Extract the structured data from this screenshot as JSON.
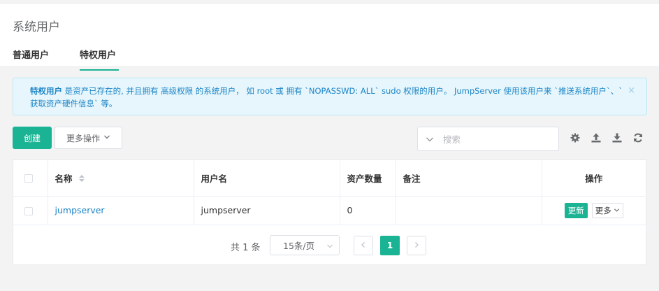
{
  "header": {
    "title": "系统用户",
    "tabs": [
      {
        "label": "普通用户",
        "active": false
      },
      {
        "label": "特权用户",
        "active": true
      }
    ]
  },
  "alert": {
    "strong": "特权用户",
    "text_line1": " 是资产已存在的, 并且拥有 高级权限 的系统用户， 如 root 或 拥有 `NOPASSWD: ALL` sudo 权限的用户。 JumpServer 使用该用户来 `推送系统用户`、`",
    "text_line2": "获取资产硬件信息` 等。",
    "close": "×"
  },
  "toolbar": {
    "create_label": "创建",
    "more_actions_label": "更多操作",
    "search_placeholder": "搜索",
    "icons": [
      "gear-icon",
      "upload-icon",
      "download-icon",
      "refresh-icon"
    ]
  },
  "table": {
    "columns": [
      "名称",
      "用户名",
      "资产数量",
      "备注",
      "操作"
    ],
    "rows": [
      {
        "name": "jumpserver",
        "username": "jumpserver",
        "asset_count": "0",
        "comment": "",
        "update_label": "更新",
        "more_label": "更多"
      }
    ]
  },
  "pagination": {
    "total_text": "共 1 条",
    "page_size_text": "15条/页",
    "current_page": "1"
  },
  "colors": {
    "accent": "#1ab394",
    "link": "#1c84c6",
    "alert_bg": "#e6f6fc"
  }
}
